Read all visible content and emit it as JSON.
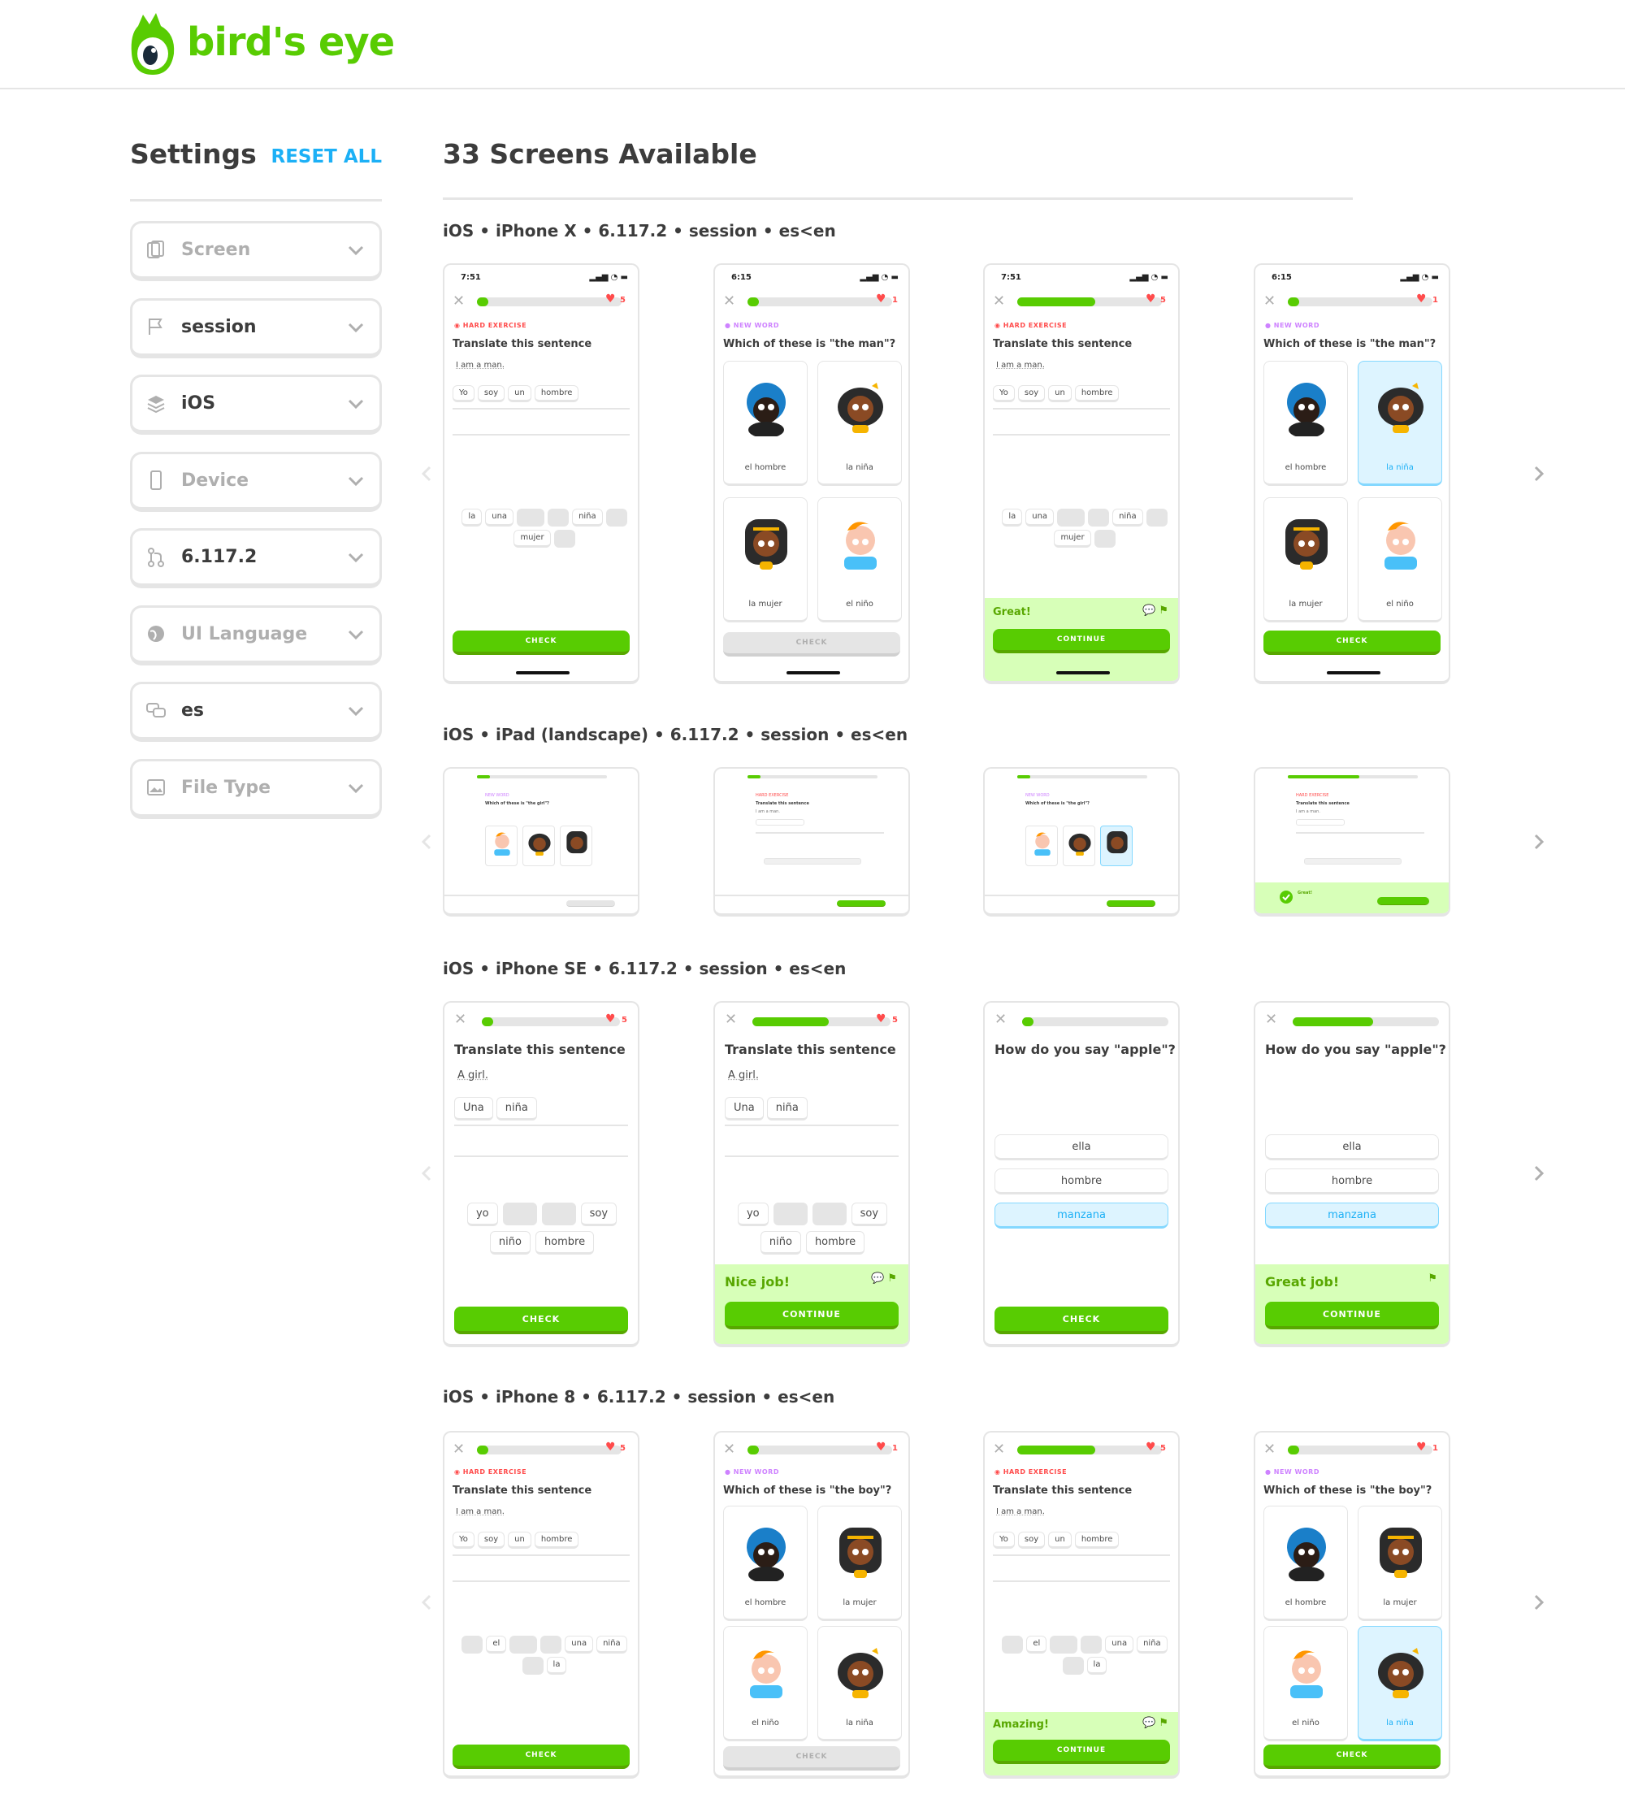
{
  "app": {
    "name": "bird's eye"
  },
  "sidebar": {
    "title": "Settings",
    "reset_label": "RESET ALL",
    "filters": [
      {
        "label": "Screen",
        "icon": "screen-icon",
        "placeholder": true
      },
      {
        "label": "session",
        "icon": "flag-icon",
        "placeholder": false
      },
      {
        "label": "iOS",
        "icon": "layers-icon",
        "placeholder": false
      },
      {
        "label": "Device",
        "icon": "device-icon",
        "placeholder": true
      },
      {
        "label": "6.117.2",
        "icon": "branch-icon",
        "placeholder": false
      },
      {
        "label": "UI Language",
        "icon": "globe-icon",
        "placeholder": true
      },
      {
        "label": "es",
        "icon": "chat-bubbles-icon",
        "placeholder": false
      },
      {
        "label": "File Type",
        "icon": "image-icon",
        "placeholder": true
      }
    ]
  },
  "main": {
    "title": "33 Screens Available",
    "sections": [
      {
        "title": "iOS • iPhone X • 6.117.2 • session • es<en"
      },
      {
        "title": "iOS • iPad (landscape) • 6.117.2 • session • es<en"
      },
      {
        "title": "iOS • iPhone SE • 6.117.2 • session • es<en"
      },
      {
        "title": "iOS • iPhone 8 • 6.117.2 • session • es<en"
      }
    ]
  },
  "common": {
    "hard_exercise": "HARD EXERCISE",
    "new_word": "NEW WORD",
    "translate": "Translate this sentence",
    "check": "CHECK",
    "continue": "CONTINUE",
    "apple_q": "How do you say \"apple\"?",
    "man_q": "Which of these is \"the man\"?",
    "boy_q": "Which of these is \"the boy\"?",
    "girl_q": "Which of these is \"the girl\"?",
    "i_am_a_man": "I am a man.",
    "a_girl": "A girl.",
    "great": "Great!",
    "nice_job": "Nice job!",
    "great_job": "Great job!",
    "amazing": "Amazing!",
    "time1": "7:51",
    "time2": "6:15",
    "hearts5": "5",
    "hearts1": "1",
    "w_yo": "Yo",
    "w_soy": "soy",
    "w_un": "un",
    "w_hombre": "hombre",
    "w_la": "la",
    "w_una": "una",
    "w_nina": "niña",
    "w_mujer": "mujer",
    "w_Una": "Una",
    "w_yo_l": "yo",
    "w_nino": "niño",
    "w_el": "el",
    "w_ella": "ella",
    "w_manzana": "manzana",
    "cap_el_hombre": "el hombre",
    "cap_la_nina": "la niña",
    "cap_la_mujer": "la mujer",
    "cap_el_nino": "el niño"
  }
}
